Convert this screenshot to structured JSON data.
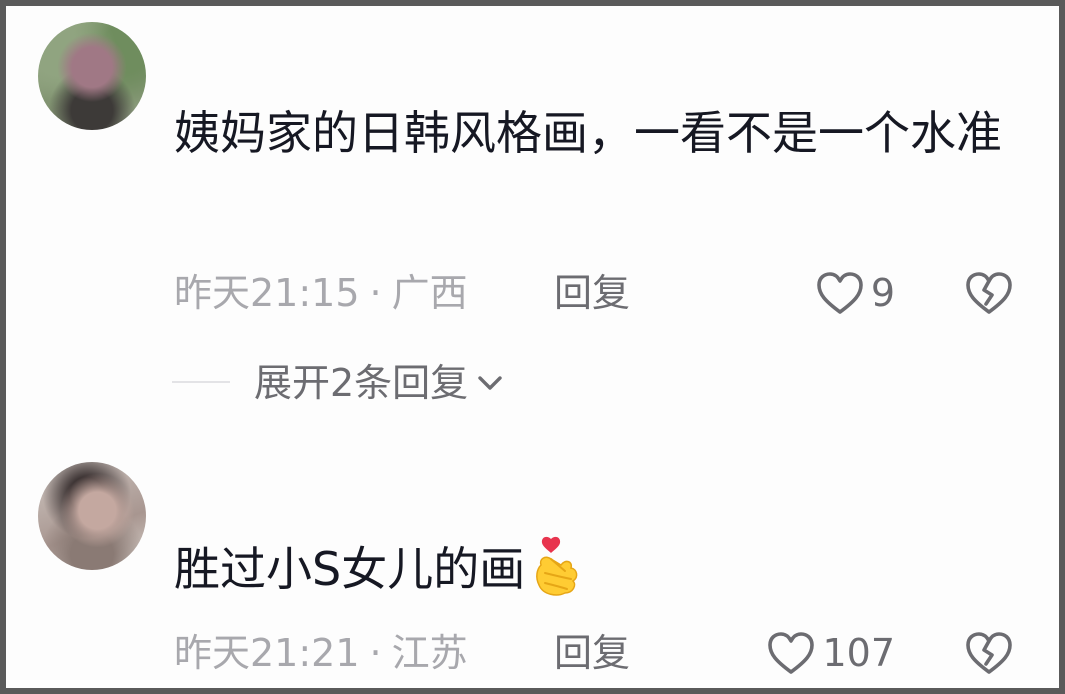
{
  "comments": [
    {
      "text": "姨妈家的日韩风格画，一看不是一个水准",
      "time": "昨天21:15",
      "separator": "·",
      "location": "广西",
      "reply_label": "回复",
      "likes": "9",
      "expand_label": "展开2条回复",
      "avatar_blurred": true
    },
    {
      "text": "胜过小S女儿的画",
      "emoji": "finger-heart-emoji",
      "time": "昨天21:21",
      "separator": "·",
      "location": "江苏",
      "reply_label": "回复",
      "likes": "107",
      "avatar_blurred": true
    }
  ],
  "icons": {
    "like": "heart-outline-icon",
    "dislike": "broken-heart-icon",
    "expand": "chevron-down-icon"
  },
  "colors": {
    "background": "#fdfdfd",
    "text_primary": "#161823",
    "text_meta": "#a8a8ad",
    "text_action": "#6c6c71"
  }
}
